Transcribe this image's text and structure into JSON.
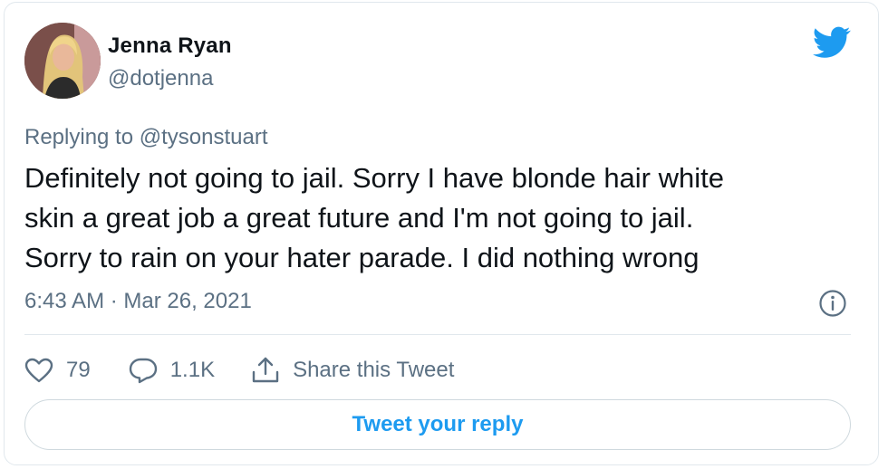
{
  "author": {
    "name": "Jenna Ryan",
    "handle": "@dotjenna"
  },
  "tweet": {
    "replying_prefix": "Replying to ",
    "replying_to": "@tysonstuart",
    "text": "Definitely not going to jail. Sorry I have blonde hair white\nskin a great job a great future and I'm not going to jail.\nSorry to rain on your hater parade. I did nothing wrong",
    "timestamp": "6:43 AM · Mar 26, 2021"
  },
  "actions": {
    "likes": "79",
    "replies": "1.1K",
    "share_label": "Share this Tweet"
  },
  "reply_button": {
    "label": "Tweet your reply"
  },
  "colors": {
    "accent": "#1d9bf0",
    "secondary_text": "#5b7083",
    "border": "#e1e8ed"
  },
  "icons": [
    "twitter-bird-icon",
    "info-icon",
    "heart-icon",
    "comment-icon",
    "share-icon"
  ]
}
